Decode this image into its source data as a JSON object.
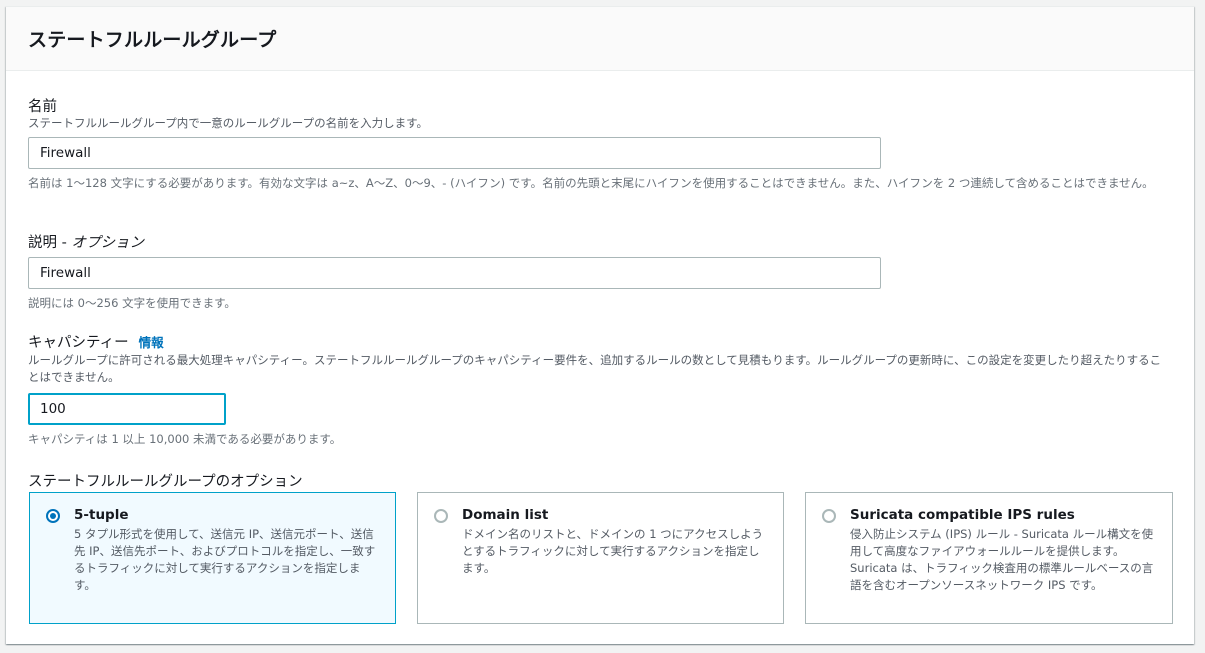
{
  "panel": {
    "title": "ステートフルルールグループ"
  },
  "name_field": {
    "label": "名前",
    "description": "ステートフルルールグループ内で一意のルールグループの名前を入力します。",
    "value": "Firewall",
    "hint": "名前は 1〜128 文字にする必要があります。有効な文字は a~z、A〜Z、0〜9、- (ハイフン) です。名前の先頭と末尾にハイフンを使用することはできません。また、ハイフンを 2 つ連続して含めることはできません。"
  },
  "description_field": {
    "label": "説明 - ",
    "label_optional": "オプション",
    "value": "Firewall",
    "hint": "説明には 0〜256 文字を使用できます。"
  },
  "capacity_field": {
    "label": "キャパシティー",
    "info_link": "情報",
    "description": "ルールグループに許可される最大処理キャパシティー。ステートフルルールグループのキャパシティー要件を、追加するルールの数として見積もります。ルールグループの更新時に、この設定を変更したり超えたりすることはできません。",
    "value": "100",
    "hint": "キャパシティは 1 以上 10,000 未満である必要があります。"
  },
  "options": {
    "label": "ステートフルルールグループのオプション",
    "selected": "5-tuple",
    "tiles": [
      {
        "title": "5-tuple",
        "description": "5 タプル形式を使用して、送信元 IP、送信元ポート、送信先 IP、送信先ポート、およびプロトコルを指定し、一致するトラフィックに対して実行するアクションを指定します。"
      },
      {
        "title": "Domain list",
        "description": "ドメイン名のリストと、ドメインの 1 つにアクセスしようとするトラフィックに対して実行するアクションを指定します。"
      },
      {
        "title": "Suricata compatible IPS rules",
        "description": "侵入防止システム (IPS) ルール - Suricata ルール構文を使用して高度なファイアウォールルールを提供します。Suricata は、トラフィック検査用の標準ルールベースの言語を含むオープンソースネットワーク IPS です。"
      }
    ]
  },
  "colors": {
    "accent": "#0073bb",
    "focus": "#00a1c9",
    "selected_bg": "#f1faff"
  }
}
